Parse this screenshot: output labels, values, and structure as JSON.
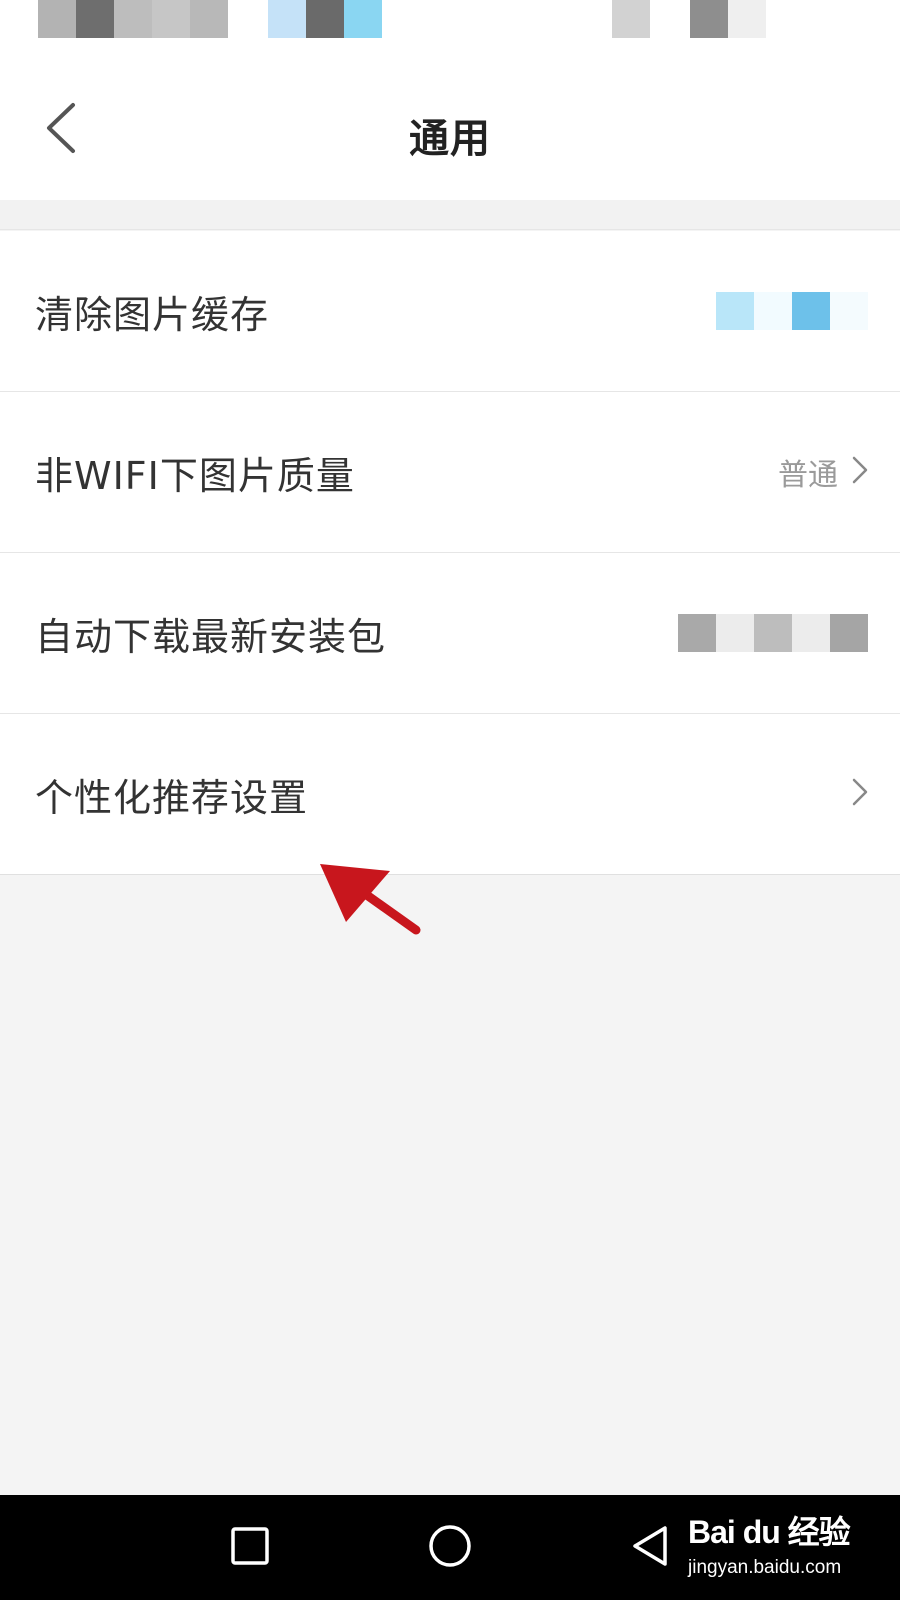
{
  "header": {
    "title": "通用",
    "back_icon": "chevron-left-icon"
  },
  "settings": [
    {
      "label": "清除图片缓存",
      "value": "",
      "chevron": false
    },
    {
      "label": "非WIFI下图片质量",
      "value": "普通",
      "chevron": true
    },
    {
      "label": "自动下载最新安装包",
      "value": "",
      "chevron": false
    },
    {
      "label": "个性化推荐设置",
      "value": "",
      "chevron": true
    }
  ],
  "nav": {
    "recent_icon": "square-icon",
    "home_icon": "circle-icon",
    "back_icon": "triangle-back-icon"
  },
  "watermark": {
    "logo": "Bai du 经验",
    "url": "jingyan.baidu.com"
  },
  "colors": {
    "annotation_arrow": "#c8161d",
    "background": "#f4f4f4",
    "row_background": "#ffffff",
    "secondary_text": "#9a9a9a"
  }
}
